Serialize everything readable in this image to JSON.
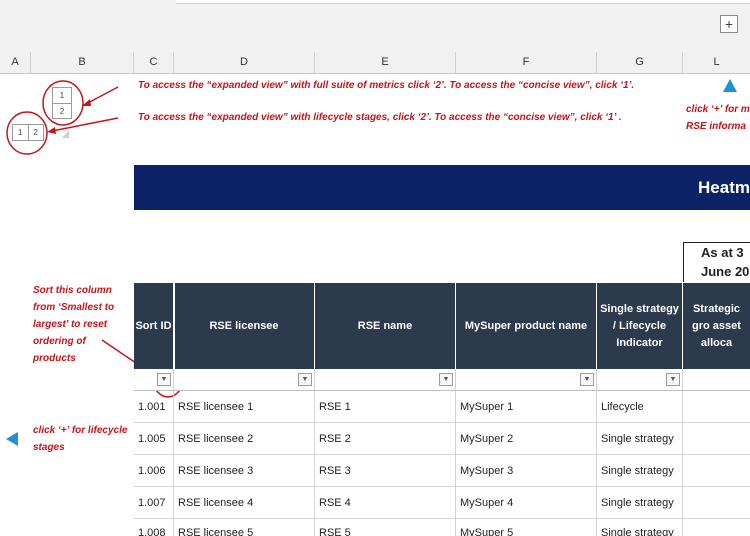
{
  "toolbar": {
    "expand_symbol": "+"
  },
  "columns": [
    "A",
    "B",
    "C",
    "D",
    "E",
    "F",
    "G",
    "L"
  ],
  "outline": {
    "level1": "1",
    "level2": "2"
  },
  "annotations": {
    "expanded_metrics": "To access the “expanded view” with full suite of metrics click ‘2’. To access the “concise view”, click ‘1’.",
    "expanded_lifecycle": "To access the “expanded view” with lifecycle stages, click ‘2’. To access the “concise view”, click ‘1’ .",
    "right_note_line1": "click ‘+’ for m",
    "right_note_line2": "RSE informa",
    "sort_note": "Sort this column from ‘Smallest to largest’ to reset ordering of products",
    "lifecycle_note": "click ‘+’ for lifecycle stages"
  },
  "banner": {
    "title": "Heatm"
  },
  "as_at": {
    "line1": "As at 3",
    "line2": "June 20"
  },
  "table": {
    "headers": [
      "Sort ID",
      "RSE licensee",
      "RSE name",
      "MySuper product name",
      "Single strategy / Lifecycle Indicator",
      "Strategic gro asset alloca"
    ],
    "rows": [
      [
        "1.001",
        "RSE licensee 1",
        "RSE 1",
        "MySuper 1",
        "Lifecycle"
      ],
      [
        "1.005",
        "RSE licensee 2",
        "RSE 2",
        "MySuper 2",
        "Single strategy"
      ],
      [
        "1.006",
        "RSE licensee 3",
        "RSE 3",
        "MySuper 3",
        "Single strategy"
      ],
      [
        "1.007",
        "RSE licensee 4",
        "RSE 4",
        "MySuper 4",
        "Single strategy"
      ],
      [
        "1.008",
        "RSE licensee 5",
        "RSE 5",
        "MySuper 5",
        "Single strategy"
      ]
    ]
  },
  "colors": {
    "banner": "#0b2265",
    "header": "#2b3a4c",
    "annotation": "#c0161d",
    "arrow": "#1e90d6"
  }
}
